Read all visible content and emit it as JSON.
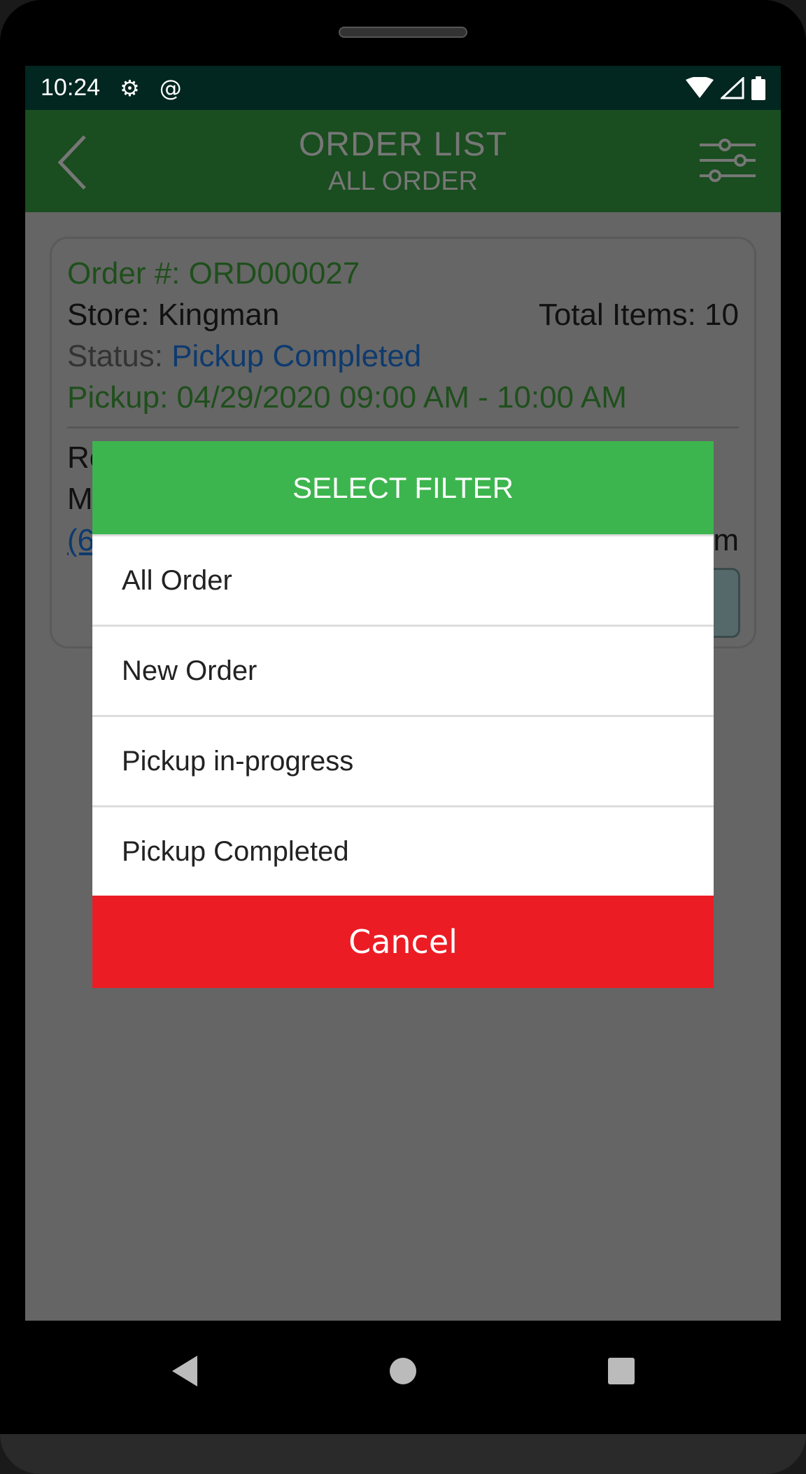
{
  "status_bar": {
    "time": "10:24",
    "icons": [
      "gear-icon",
      "at-sign-icon",
      "wifi-icon",
      "signal-icon",
      "battery-icon"
    ]
  },
  "app_bar": {
    "title": "ORDER LIST",
    "subtitle": "ALL ORDER"
  },
  "order_card": {
    "order_label": "Order #:",
    "order_number": "ORD000027",
    "store_label": "Store:",
    "store": "Kingman",
    "total_items_label": "Total Items:",
    "total_items": "10",
    "status_label": "Status:",
    "status": "Pickup Completed",
    "pickup_label": "Pickup:",
    "pickup": "04/29/2020 09:00 AM - 10:00 AM",
    "partial_1": "Ro",
    "partial_2": "M",
    "partial_3": "(6",
    "partial_4": "m"
  },
  "dialog": {
    "title": "SELECT FILTER",
    "options": [
      "All Order",
      "New Order",
      "Pickup in-progress",
      "Pickup Completed"
    ],
    "cancel": "Cancel"
  },
  "colors": {
    "dialog_header": "#3db54e",
    "cancel": "#ec1c24",
    "app_bar": "#1a4d1f"
  }
}
